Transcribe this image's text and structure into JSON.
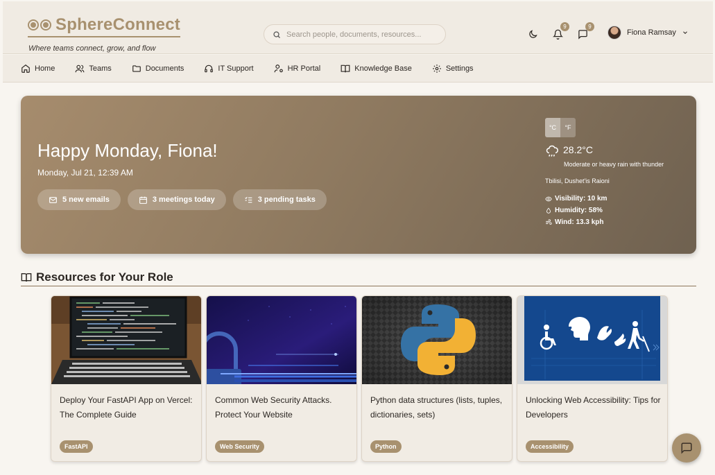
{
  "app": {
    "name": "SphereConnect",
    "tagline": "Where teams connect, grow, and flow"
  },
  "search": {
    "placeholder": "Search people, documents, resources..."
  },
  "header": {
    "notifications_count": "9",
    "messages_count": "9",
    "user_name": "Fiona Ramsay"
  },
  "nav": {
    "items": [
      {
        "label": "Home",
        "icon": "home-icon"
      },
      {
        "label": "Teams",
        "icon": "users-icon"
      },
      {
        "label": "Documents",
        "icon": "folder-icon"
      },
      {
        "label": "IT Support",
        "icon": "headset-icon"
      },
      {
        "label": "HR Portal",
        "icon": "user-cog-icon"
      },
      {
        "label": "Knowledge Base",
        "icon": "book-icon"
      },
      {
        "label": "Settings",
        "icon": "gear-icon"
      }
    ]
  },
  "hero": {
    "greeting": "Happy Monday, Fiona!",
    "datetime": "Monday, Jul 21, 12:39 AM",
    "pills": [
      {
        "label": "5 new emails",
        "icon": "mail-icon"
      },
      {
        "label": "3 meetings today",
        "icon": "calendar-icon"
      },
      {
        "label": "3 pending tasks",
        "icon": "tasks-icon"
      }
    ]
  },
  "weather": {
    "unit_c": "°C",
    "unit_f": "°F",
    "active_unit": "C",
    "temperature": "28.2°C",
    "condition": "Moderate or heavy rain with thunder",
    "location": "Tbilisi, Dushet'is Raioni",
    "visibility": "Visibility: 10 km",
    "humidity": "Humidity: 58%",
    "wind": "Wind: 13.3 kph"
  },
  "resources": {
    "title": "Resources for Your Role",
    "cards": [
      {
        "title": "Deploy Your FastAPI App on Vercel: The Complete Guide",
        "tag": "FastAPI"
      },
      {
        "title": "Common Web Security Attacks. Protect Your Website",
        "tag": "Web Security"
      },
      {
        "title": "Python data structures (lists, tuples, dictionaries, sets)",
        "tag": "Python"
      },
      {
        "title": "Unlocking Web Accessibility: Tips for Developers",
        "tag": "Accessibility"
      }
    ]
  },
  "colors": {
    "accent": "#a8916f",
    "background": "#f8f5f0",
    "header_bg": "#f0ebe3"
  }
}
